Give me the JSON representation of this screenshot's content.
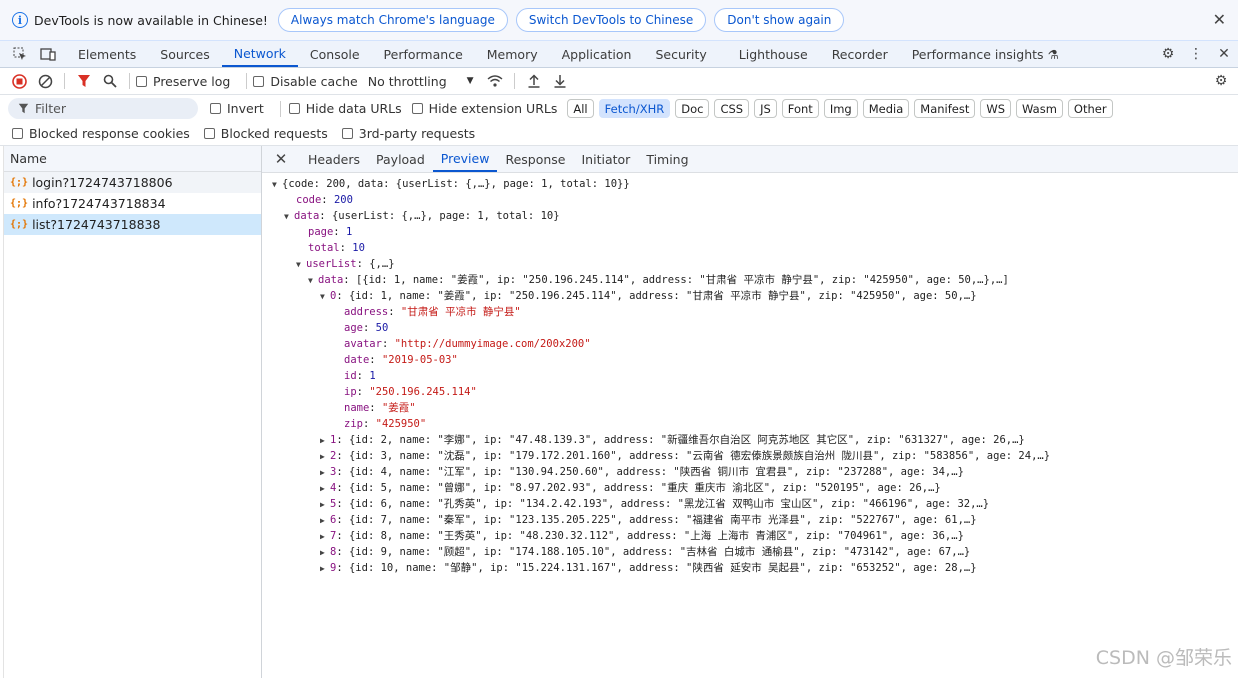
{
  "infobar": {
    "message": "DevTools is now available in Chinese!",
    "btn_match": "Always match Chrome's language",
    "btn_switch": "Switch DevTools to Chinese",
    "btn_dont_show": "Don't show again"
  },
  "main_tabs": [
    "Elements",
    "Sources",
    "Network",
    "Console",
    "Performance",
    "Memory",
    "Application",
    "Security",
    "Lighthouse",
    "Recorder",
    "Performance insights"
  ],
  "toolbar": {
    "preserve_log": "Preserve log",
    "disable_cache": "Disable cache",
    "throttling": "No throttling"
  },
  "filter": {
    "placeholder": "Filter",
    "invert": "Invert",
    "hide_data_urls": "Hide data URLs",
    "hide_extension_urls": "Hide extension URLs",
    "types": [
      "All",
      "Fetch/XHR",
      "Doc",
      "CSS",
      "JS",
      "Font",
      "Img",
      "Media",
      "Manifest",
      "WS",
      "Wasm",
      "Other"
    ],
    "blocked_cookies": "Blocked response cookies",
    "blocked_requests": "Blocked requests",
    "third_party": "3rd-party requests"
  },
  "requests": {
    "header": "Name",
    "items": [
      "login?1724743718806",
      "info?1724743718834",
      "list?1724743718838"
    ]
  },
  "detail_tabs": [
    "Headers",
    "Payload",
    "Preview",
    "Response",
    "Initiator",
    "Timing"
  ],
  "preview": {
    "root": "{code: 200, data: {userList: {,…}, page: 1, total: 10}}",
    "code": "200",
    "data_summary": "{userList: {,…}, page: 1, total: 10}",
    "page": "1",
    "total": "10",
    "userList_summary": "{,…}",
    "data_array_summary": "[{id: 1, name: \"姜霞\", ip: \"250.196.245.114\", address: \"甘肃省 平凉市 静宁县\", zip: \"425950\", age: 50,…},…]",
    "item0_summary": "{id: 1, name: \"姜霞\", ip: \"250.196.245.114\", address: \"甘肃省 平凉市 静宁县\", zip: \"425950\", age: 50,…}",
    "item0": {
      "address": "\"甘肃省 平凉市 静宁县\"",
      "age": "50",
      "avatar": "\"http://dummyimage.com/200x200\"",
      "date": "\"2019-05-03\"",
      "id": "1",
      "ip": "\"250.196.245.114\"",
      "name": "\"姜霞\"",
      "zip": "\"425950\""
    },
    "rows": [
      {
        "idx": "1",
        "text": "{id: 2, name: \"李娜\", ip: \"47.48.139.3\", address: \"新疆维吾尔自治区 阿克苏地区 其它区\", zip: \"631327\", age: 26,…}"
      },
      {
        "idx": "2",
        "text": "{id: 3, name: \"沈磊\", ip: \"179.172.201.160\", address: \"云南省 德宏傣族景颇族自治州 陇川县\", zip: \"583856\", age: 24,…}"
      },
      {
        "idx": "3",
        "text": "{id: 4, name: \"江军\", ip: \"130.94.250.60\", address: \"陕西省 铜川市 宜君县\", zip: \"237288\", age: 34,…}"
      },
      {
        "idx": "4",
        "text": "{id: 5, name: \"曾娜\", ip: \"8.97.202.93\", address: \"重庆 重庆市 渝北区\", zip: \"520195\", age: 26,…}"
      },
      {
        "idx": "5",
        "text": "{id: 6, name: \"孔秀英\", ip: \"134.2.42.193\", address: \"黑龙江省 双鸭山市 宝山区\", zip: \"466196\", age: 32,…}"
      },
      {
        "idx": "6",
        "text": "{id: 7, name: \"秦军\", ip: \"123.135.205.225\", address: \"福建省 南平市 光泽县\", zip: \"522767\", age: 61,…}"
      },
      {
        "idx": "7",
        "text": "{id: 8, name: \"王秀英\", ip: \"48.230.32.112\", address: \"上海 上海市 青浦区\", zip: \"704961\", age: 36,…}"
      },
      {
        "idx": "8",
        "text": "{id: 9, name: \"顾超\", ip: \"174.188.105.10\", address: \"吉林省 白城市 通榆县\", zip: \"473142\", age: 67,…}"
      },
      {
        "idx": "9",
        "text": "{id: 10, name: \"邹静\", ip: \"15.224.131.167\", address: \"陕西省 延安市 吴起县\", zip: \"653252\", age: 28,…}"
      }
    ]
  },
  "watermark": "CSDN @邹荣乐"
}
